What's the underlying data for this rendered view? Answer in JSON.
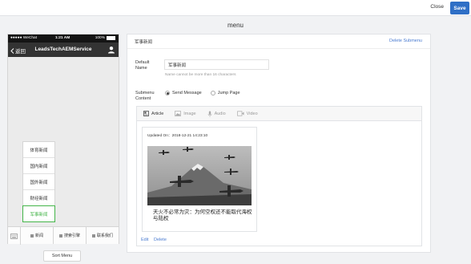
{
  "topbar": {
    "close_label": "Close",
    "save_label": "Save"
  },
  "page_title": "menu",
  "phone": {
    "carrier": "●●●●● WeChat",
    "time": "1:21 AM",
    "battery": "100%",
    "back_label": "返回",
    "account_name": "LeadsTechAEMService",
    "submenu_items": [
      "体育新闻",
      "国内新闻",
      "国外新闻",
      "财经新闻",
      "军事新闻"
    ],
    "bottom_menu": [
      "新闻",
      "搜索引擎",
      "联系我们"
    ]
  },
  "sort_menu_label": "Sort Menu",
  "editor": {
    "header_title": "军事新闻",
    "delete_submenu_label": "Delete Submenu",
    "name_label_line1": "Default",
    "name_label_line2": "Name",
    "name_value": "军事新闻",
    "name_hint": "Name cannot be more than 16 characters",
    "content_label_line1": "Submenu",
    "content_label_line2": "Content",
    "option_send": "Send Message",
    "option_jump": "Jump Page",
    "tabs": [
      "Article",
      "Image",
      "Audio",
      "Video"
    ],
    "article": {
      "updated": "Updated On：2018-12-21 14:23:10",
      "title": "天火不必常为灾：为何空权还不能取代海权与陆权"
    },
    "edit_label": "Edit",
    "delete_label": "Delete"
  }
}
